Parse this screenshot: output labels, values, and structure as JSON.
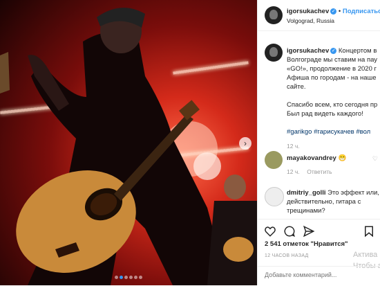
{
  "post": {
    "slide_count": 6,
    "active_slide": 2
  },
  "header": {
    "username": "igorsukachev",
    "follow_label": "Подписаться",
    "location": "Volgograd, Russia"
  },
  "caption": {
    "username": "igorsukachev",
    "lines": [
      "Концертом в",
      "Волгограде мы ставим на пау",
      "«GO!», продолжение в 2020 г",
      "Афиша по городам - на наше",
      "сайте.",
      "",
      "Спасибо всем, кто сегодня пр",
      "Был рад видеть каждого!",
      ""
    ],
    "hashtags": "#garikgo #гарисукачев #вол",
    "time": "12 ч."
  },
  "comments": [
    {
      "username": "mayakovandrey",
      "emoji": "😁",
      "time": "12 ч.",
      "reply_label": "Ответить"
    },
    {
      "username": "dmitriy_golli",
      "text_lines": [
        "Это эффект или,",
        "действительно, гитара с",
        "трещинами?"
      ]
    }
  ],
  "actions": {
    "likes": "2 541 отметок \"Нравится\"",
    "ago": "12 ЧАСОВ НАЗАД"
  },
  "add_comment": {
    "placeholder": "Добавьте комментарий..."
  },
  "watermark": {
    "line1": "Актива",
    "line2": "Чтобы ак"
  },
  "icons": [
    "heart-icon",
    "comment-icon",
    "share-icon",
    "bookmark-icon",
    "verified-icon",
    "chevron-right-icon"
  ],
  "colors": {
    "accent": "#3897f0",
    "hashtag": "#003569",
    "stage_red": "#d42a1a"
  }
}
